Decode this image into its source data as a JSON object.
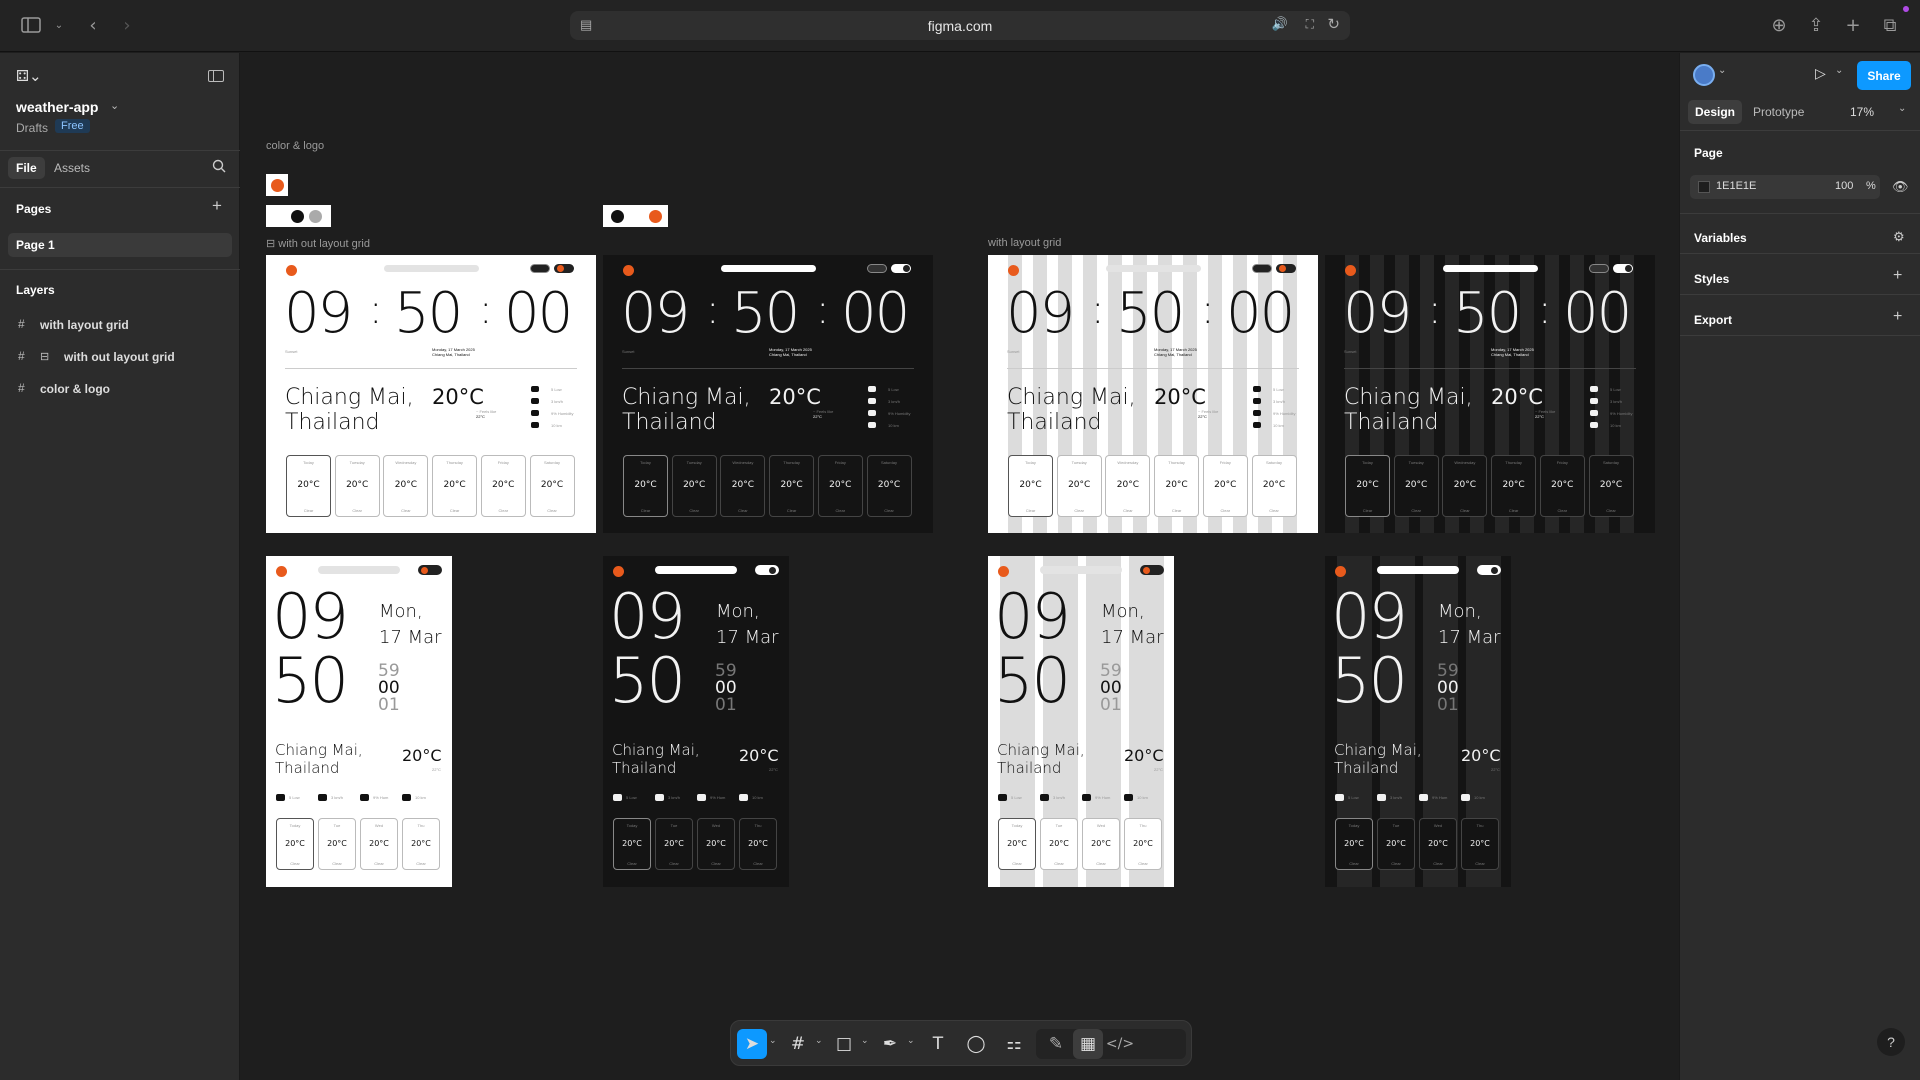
{
  "browser": {
    "url": "figma.com"
  },
  "file": {
    "name": "weather-app",
    "location": "Drafts",
    "plan_badge": "Free"
  },
  "left_tabs": {
    "file": "File",
    "assets": "Assets"
  },
  "pages": {
    "heading": "Pages",
    "items": [
      "Page 1"
    ]
  },
  "layers": {
    "heading": "Layers",
    "items": [
      "with layout grid",
      "with out layout grid",
      "color & logo"
    ]
  },
  "right_panel": {
    "tabs": {
      "design": "Design",
      "prototype": "Prototype"
    },
    "zoom": "17%",
    "share_label": "Share",
    "page_section": "Page",
    "page_color": "1E1E1E",
    "page_opacity": "100",
    "percent_sign": "%",
    "sections": [
      "Variables",
      "Styles",
      "Export"
    ]
  },
  "canvas": {
    "frame_labels": {
      "color_logo": "color & logo",
      "without_grid": "with out layout grid",
      "with_grid": "with layout grid"
    },
    "desktop": {
      "time": [
        "09",
        "50",
        "00"
      ],
      "sunset": "Sunset",
      "date_lines": [
        "Monday, 17 March 2025",
        "Chiang Mai, Thailand"
      ],
      "city": [
        "Chiang Mai,",
        "Thailand"
      ],
      "temp": "20°C",
      "feels": [
        "~ Feels like",
        "22°C"
      ],
      "metrics": [
        "5 Low",
        "3 km/h",
        "9% Humidity",
        "10 km"
      ],
      "days": [
        "Today",
        "Tuesday",
        "Wednesday",
        "Thursday",
        "Friday",
        "Saturday"
      ],
      "day_temp": "20°C",
      "condition": "Clear"
    },
    "mobile": {
      "hour": "09",
      "minute": "50",
      "date": [
        "Mon,",
        "17 Mar"
      ],
      "seconds": [
        "59",
        "00",
        "01"
      ],
      "city": [
        "Chiang Mai,",
        "Thailand"
      ],
      "temp": "20°C",
      "temp_sub": "22°C",
      "metrics": [
        "5 Low",
        "3 km/h",
        "9% Hum",
        "10 km"
      ],
      "days": [
        "Today",
        "Tue",
        "Wed",
        "Thu"
      ],
      "day_temp": "20°C",
      "condition": "Clear"
    }
  },
  "colors": {
    "accent": "#E85A1C",
    "figma_blue": "#0D99FF",
    "canvas_bg": "#1E1E1E"
  }
}
